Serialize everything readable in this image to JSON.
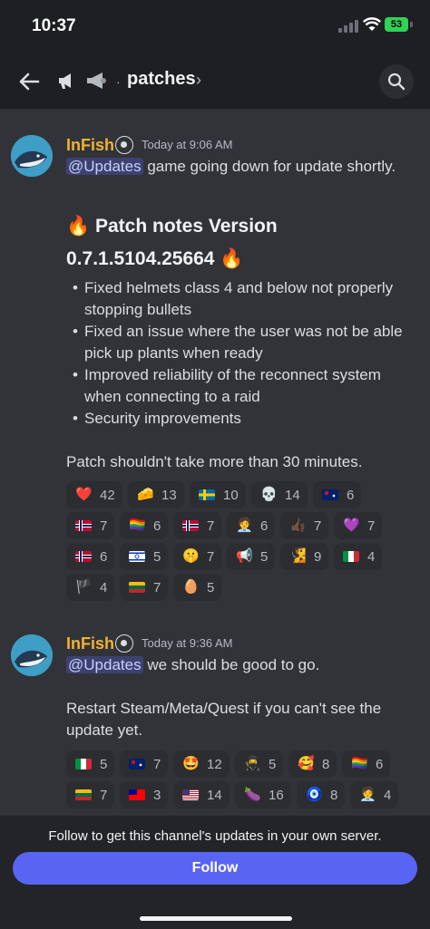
{
  "status_bar": {
    "time": "10:37",
    "battery": "53"
  },
  "header": {
    "channel": "patches",
    "separator": "·",
    "chevron": "›"
  },
  "messages": [
    {
      "author": "InFish",
      "timestamp": "Today at 9:06 AM",
      "mention": "@Updates",
      "text": "game going down for update shortly.",
      "heading_line1": "🔥 Patch notes Version",
      "heading_line2": "0.7.1.5104.25664 🔥",
      "bullets": [
        {
          "line1": "Fixed helmets class 4 and below not properly",
          "line2": "stopping bullets"
        },
        {
          "line1": "Fixed an issue where the user was not be able",
          "line2": "pick up plants when ready"
        },
        {
          "line1": "Improved reliability of the reconnect system",
          "line2": "when connecting to a raid"
        },
        {
          "line1": "Security improvements",
          "line2": ""
        }
      ],
      "footer_text": "Patch shouldn't take more than 30 minutes.",
      "reactions": [
        {
          "emoji": "❤️",
          "count": "42"
        },
        {
          "emoji": "🧀",
          "count": "13"
        },
        {
          "emoji": "flag-se",
          "count": "10"
        },
        {
          "emoji": "💀",
          "count": "14"
        },
        {
          "emoji": "flag-au",
          "count": "6"
        },
        {
          "emoji": "flag-no",
          "count": "7"
        },
        {
          "emoji": "🏳️‍🌈",
          "count": "6"
        },
        {
          "emoji": "flag-no",
          "count": "7"
        },
        {
          "emoji": "🧑‍💼",
          "count": "6"
        },
        {
          "emoji": "👍🏿",
          "count": "7"
        },
        {
          "emoji": "💜",
          "count": "7"
        },
        {
          "emoji": "flag-no",
          "count": "6"
        },
        {
          "emoji": "flag-il",
          "count": "5"
        },
        {
          "emoji": "🤫",
          "count": "7"
        },
        {
          "emoji": "📢",
          "count": "5"
        },
        {
          "emoji": "🧏",
          "count": "9"
        },
        {
          "emoji": "flag-it",
          "count": "4"
        },
        {
          "emoji": "🏴",
          "count": "4"
        },
        {
          "emoji": "flag-lt",
          "count": "7"
        },
        {
          "emoji": "🥚",
          "count": "5"
        }
      ]
    },
    {
      "author": "InFish",
      "timestamp": "Today at 9:36 AM",
      "mention": "@Updates",
      "text": "we should be good to go.",
      "line2": "Restart Steam/Meta/Quest if you can't see the",
      "line3": "update yet.",
      "reactions": [
        {
          "emoji": "flag-it",
          "count": "5"
        },
        {
          "emoji": "flag-au",
          "count": "7"
        },
        {
          "emoji": "🤩",
          "count": "12"
        },
        {
          "emoji": "🥷",
          "count": "5"
        },
        {
          "emoji": "🥰",
          "count": "8"
        },
        {
          "emoji": "🏳️‍🌈",
          "count": "6"
        },
        {
          "emoji": "flag-lt",
          "count": "7"
        },
        {
          "emoji": "flag-tw",
          "count": "3"
        },
        {
          "emoji": "flag-us",
          "count": "14"
        },
        {
          "emoji": "🍆",
          "count": "16"
        },
        {
          "emoji": "🧿",
          "count": "8"
        },
        {
          "emoji": "🧑‍💼",
          "count": "4"
        }
      ]
    }
  ],
  "bottom_bar": {
    "follow_text": "Follow to get this channel's updates in your own server.",
    "follow_label": "Follow"
  },
  "colors": {
    "background": "#313338",
    "accent": "#5865f2",
    "author": "#f0b232",
    "mention": "#c9cdfb"
  }
}
